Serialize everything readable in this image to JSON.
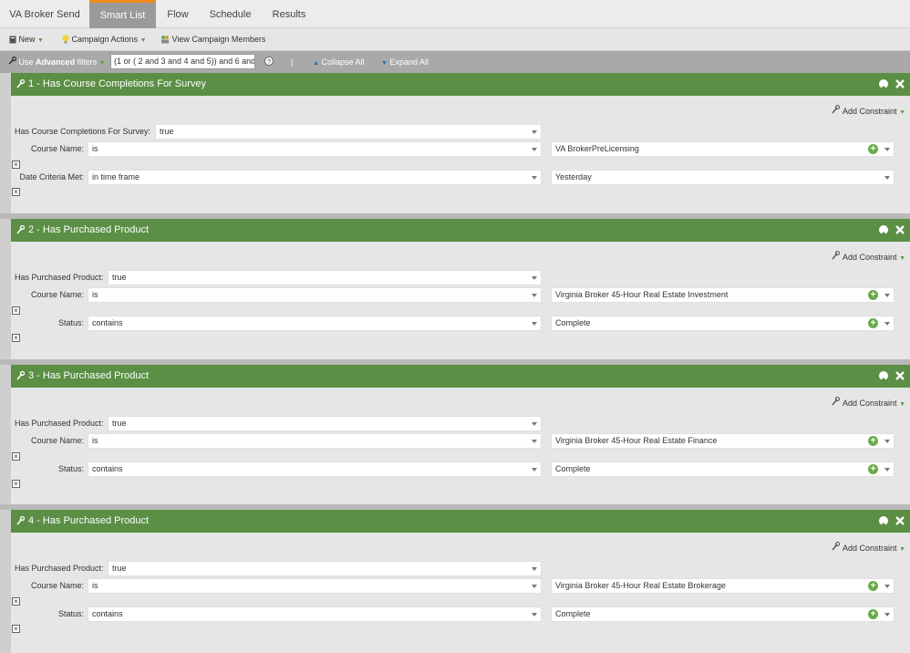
{
  "tabs": [
    {
      "label": "VA Broker Send"
    },
    {
      "label": "Smart List"
    },
    {
      "label": "Flow"
    },
    {
      "label": "Schedule"
    },
    {
      "label": "Results"
    }
  ],
  "toolbar": {
    "new_label": "New",
    "campaign_actions_label": "Campaign Actions",
    "view_members_label": "View Campaign Members"
  },
  "filterbar": {
    "use_label": "Use",
    "advanced_label": "Advanced",
    "filters_label": "filters",
    "logic_value": "(1 or ( 2 and 3 and 4 and 5)) and 6 and",
    "separator": "|",
    "collapse_label": "Collapse All",
    "expand_label": "Expand All"
  },
  "filters": [
    {
      "title": "1 - Has Course Completions For Survey",
      "add_constraint": "Add Constraint",
      "primary_label": "Has Course Completions For Survey:",
      "primary_value": "true",
      "row1_label": "Course Name:",
      "row1_op": "is",
      "row1_value": "VA BrokerPreLicensing",
      "row2_label": "Date Criteria Met:",
      "row2_op": "in time frame",
      "row2_value": "Yesterday"
    },
    {
      "title": "2 - Has Purchased Product",
      "add_constraint": "Add Constraint",
      "primary_label": "Has Purchased Product:",
      "primary_value": "true",
      "row1_label": "Course Name:",
      "row1_op": "is",
      "row1_value": "Virginia Broker 45-Hour Real Estate Investment",
      "row2_label": "Status:",
      "row2_op": "contains",
      "row2_value": "Complete"
    },
    {
      "title": "3 - Has Purchased Product",
      "add_constraint": "Add Constraint",
      "primary_label": "Has Purchased Product:",
      "primary_value": "true",
      "row1_label": "Course Name:",
      "row1_op": "is",
      "row1_value": "Virginia Broker 45-Hour Real Estate Finance",
      "row2_label": "Status:",
      "row2_op": "contains",
      "row2_value": "Complete"
    },
    {
      "title": "4 - Has Purchased Product",
      "add_constraint": "Add Constraint",
      "primary_label": "Has Purchased Product:",
      "primary_value": "true",
      "row1_label": "Course Name:",
      "row1_op": "is",
      "row1_value": "Virginia Broker 45-Hour Real Estate Brokerage",
      "row2_label": "Status:",
      "row2_op": "contains",
      "row2_value": "Complete"
    }
  ],
  "colors": {
    "accent_orange": "#f28a1c",
    "header_green": "#5b8f45",
    "plus_green": "#6aab4a"
  }
}
